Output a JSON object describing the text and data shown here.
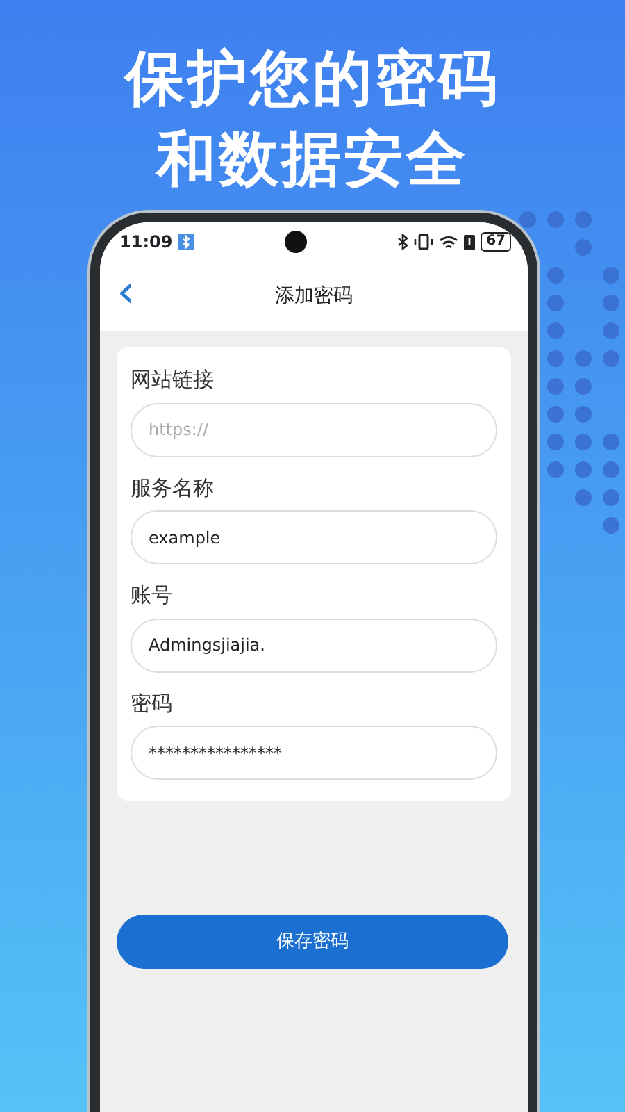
{
  "headline": [
    "保护您的密码",
    "和数据安全"
  ],
  "status_bar": {
    "time": "11:09",
    "battery": "67"
  },
  "nav": {
    "back": "‹",
    "title": "添加密码"
  },
  "form": [
    {
      "label": "网站链接",
      "placeholder": "https://"
    },
    {
      "label": "服务名称",
      "value": "example"
    },
    {
      "label": "账号",
      "value": "Admingsjiajia."
    },
    {
      "label": "密码",
      "value": "****************"
    }
  ],
  "save_button": "保存密码"
}
